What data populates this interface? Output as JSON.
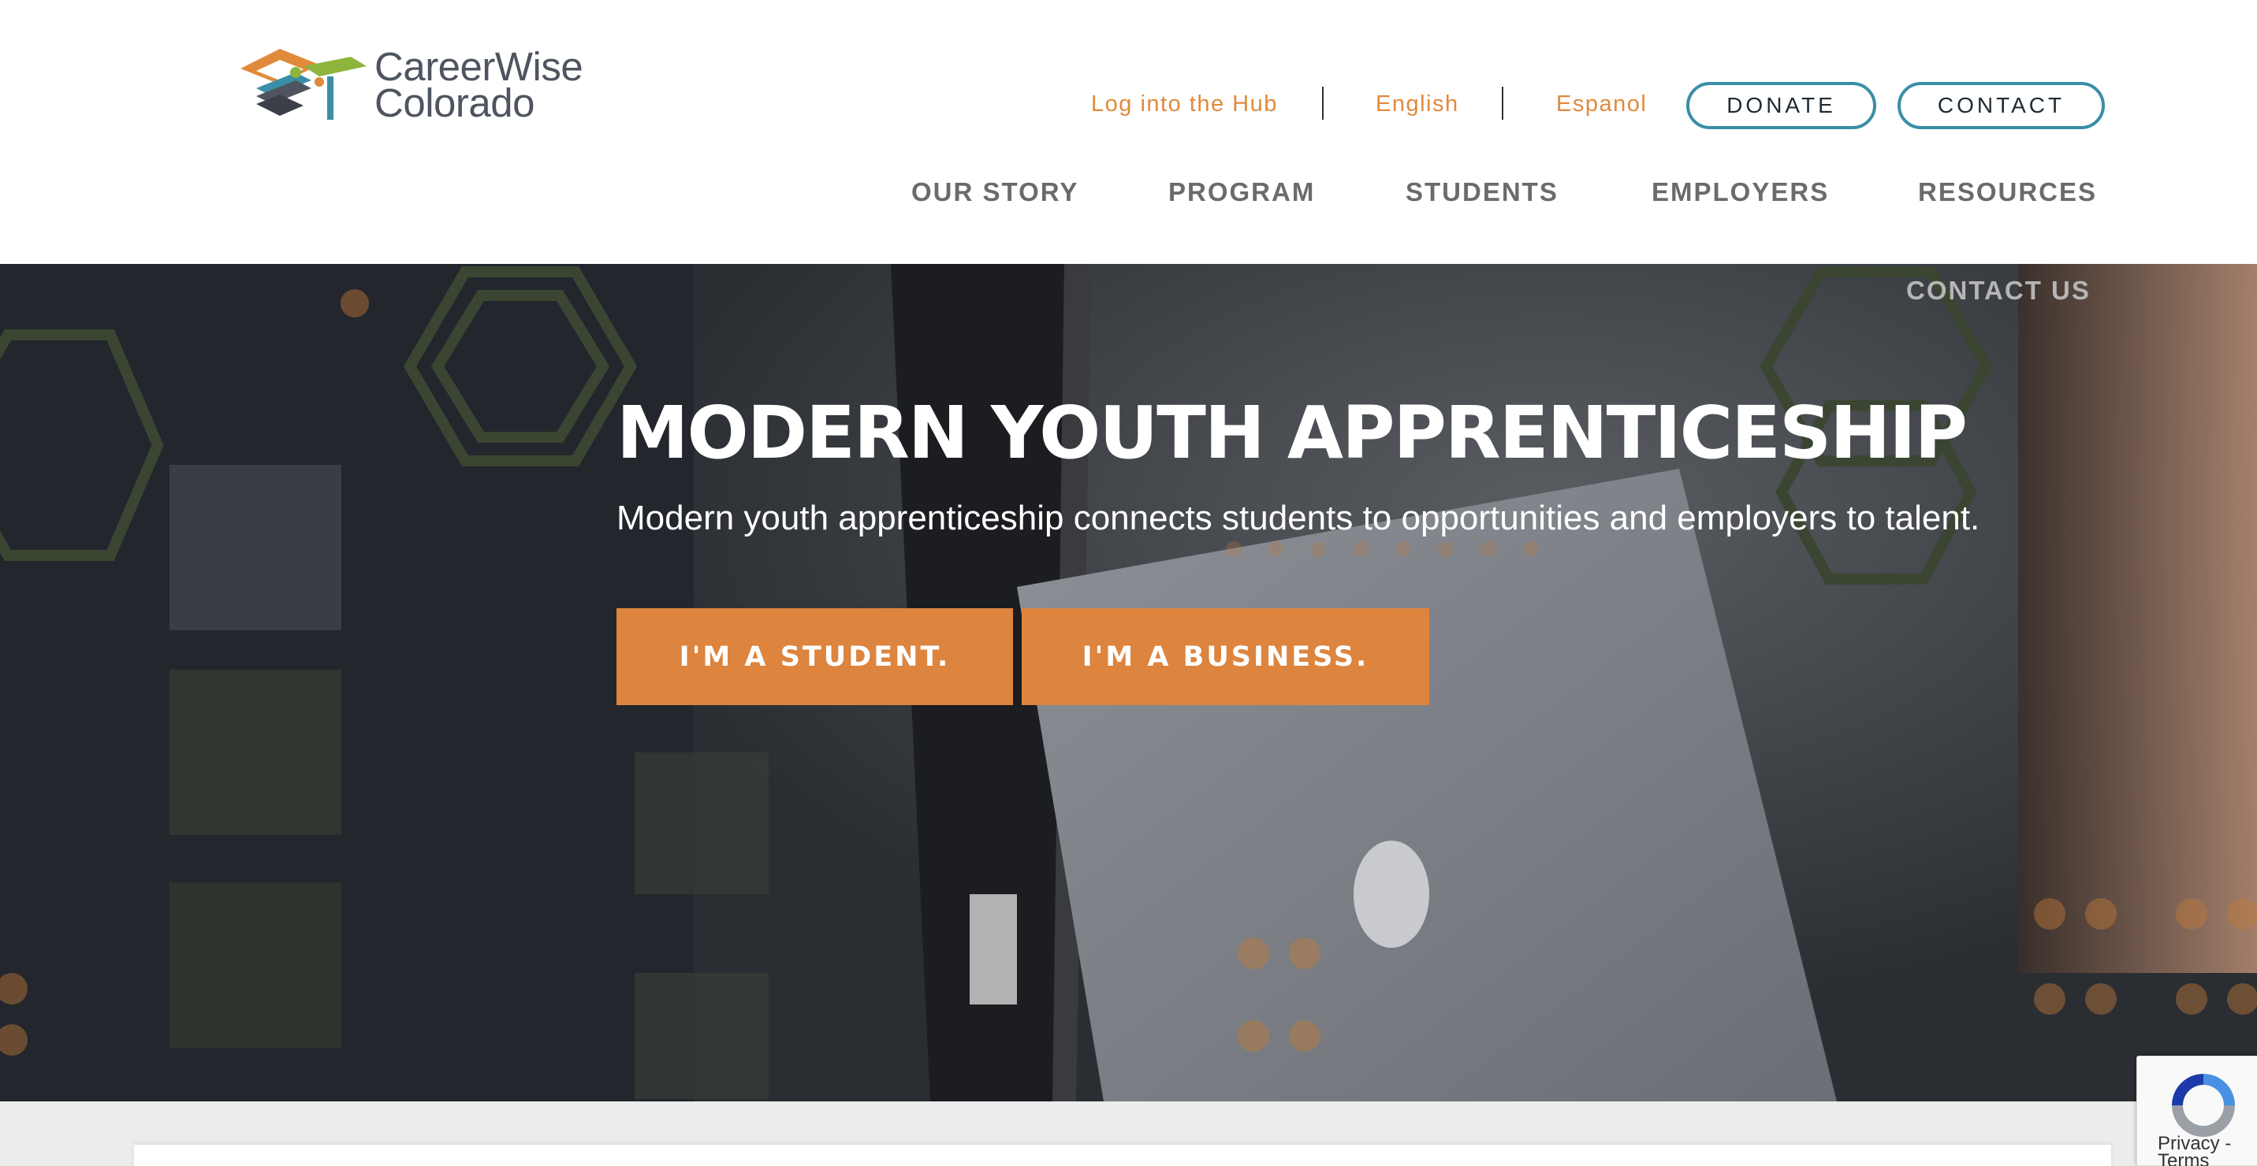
{
  "brand": {
    "name_line1": "CareerWise",
    "name_line2": "Colorado",
    "colors": {
      "orange": "#e08a3c",
      "green": "#8db53c",
      "teal": "#3a8ea6",
      "slate": "#4e5560"
    }
  },
  "utility_nav": {
    "login": "Log into the Hub",
    "english": "English",
    "espanol": "Espanol",
    "donate": "DONATE",
    "contact": "CONTACT"
  },
  "main_nav": {
    "items": [
      "OUR STORY",
      "PROGRAM",
      "STUDENTS",
      "EMPLOYERS",
      "RESOURCES"
    ],
    "overflow_item": "CONTACT US"
  },
  "hero": {
    "title": "MODERN YOUTH APPRENTICESHIP",
    "subtitle": "Modern youth apprenticeship connects students to opportunities and employers to talent.",
    "cta_student": "I'M A STUDENT.",
    "cta_business": "I'M A BUSINESS.",
    "cta_color": "#dd843e"
  },
  "recaptcha": {
    "privacy": "Privacy",
    "separator": " - ",
    "terms": "Terms"
  }
}
